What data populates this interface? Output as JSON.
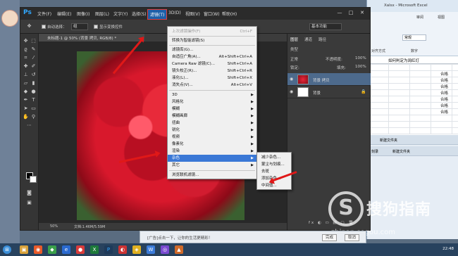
{
  "excel": {
    "title": "Xalsx - Microsoft Excel",
    "tabs": [
      "审阅",
      "视图"
    ],
    "number_format": "常规",
    "group_label": "对齐方式",
    "number_group": "数字",
    "formula": "如何判定为阔红灯",
    "cell_values": [
      "合格",
      "合格",
      "合格",
      "合格",
      "合格",
      "合格",
      "合格"
    ],
    "panel_row1": "新建文件夹",
    "panel_row2a": "刻录",
    "panel_row2b": "新建文件夹"
  },
  "ps": {
    "logo": "Ps",
    "menu": [
      "文件(F)",
      "编辑(E)",
      "图像(I)",
      "图层(L)",
      "文字(Y)",
      "选择(S)",
      "滤镜(T)",
      "3D(D)",
      "视图(V)",
      "窗口(W)",
      "帮助(H)"
    ],
    "active_menu": "滤镜(T)",
    "options": {
      "auto_select": "自动选择：",
      "auto_select_value": "组",
      "show_transform": "显示变换控件",
      "workspace": "基本功能"
    },
    "doc_tab": "未标题-1 @ 50% (背景 拷贝, RGB/8) *",
    "status_zoom": "50%",
    "status_doc": "文档:1.46M/5.59M",
    "window_buttons": [
      "—",
      "□",
      "✕"
    ]
  },
  "filter_menu": {
    "items": [
      {
        "label": "上次滤镜操作(F)",
        "shortcut": "Ctrl+F",
        "disabled": true
      },
      {
        "label": "转换为智能滤镜(S)"
      },
      {
        "label": "滤镜库(G)..."
      },
      {
        "label": "自适应广角(A)...",
        "shortcut": "Alt+Shift+Ctrl+A"
      },
      {
        "label": "Camera Raw 滤镜(C)...",
        "shortcut": "Shift+Ctrl+A"
      },
      {
        "label": "镜头校正(R)...",
        "shortcut": "Shift+Ctrl+R"
      },
      {
        "label": "液化(L)...",
        "shortcut": "Shift+Ctrl+X"
      },
      {
        "label": "消失点(V)...",
        "shortcut": "Alt+Ctrl+V"
      },
      {
        "label": "3D",
        "submenu": true
      },
      {
        "label": "风格化",
        "submenu": true
      },
      {
        "label": "模糊",
        "submenu": true
      },
      {
        "label": "模糊画廊",
        "submenu": true
      },
      {
        "label": "扭曲",
        "submenu": true
      },
      {
        "label": "锐化",
        "submenu": true
      },
      {
        "label": "视频",
        "submenu": true
      },
      {
        "label": "像素化",
        "submenu": true
      },
      {
        "label": "渲染",
        "submenu": true
      },
      {
        "label": "杂色",
        "submenu": true,
        "highlighted": true
      },
      {
        "label": "其它",
        "submenu": true
      },
      {
        "label": "浏览联机滤镜..."
      }
    ]
  },
  "noise_submenu": {
    "items": [
      "减少杂色...",
      "蒙尘与划痕...",
      "去斑",
      "添加杂色...",
      "中间值..."
    ]
  },
  "layers": {
    "tabs": [
      "图层",
      "通道",
      "路径"
    ],
    "kind_label": "类型",
    "blend_mode": "正常",
    "opacity_label": "不透明度:",
    "opacity_value": "100%",
    "lock_label": "锁定:",
    "fill_label": "填充:",
    "fill_value": "100%",
    "rows": [
      {
        "name": "背景 拷贝",
        "selected": true
      },
      {
        "name": "背景",
        "selected": false
      }
    ],
    "footer_icons": "fx ◐ ▭ ▤ ▢ 🗑"
  },
  "notification": {
    "text": "[广告]点击一下，让你的生活更精彩！",
    "button1": "完成",
    "button2": "取消"
  },
  "taskbar": {
    "clock": "22:48"
  },
  "watermark": {
    "logo": "S",
    "title": "搜狗指南",
    "url": "zhinan.sogou.com"
  }
}
